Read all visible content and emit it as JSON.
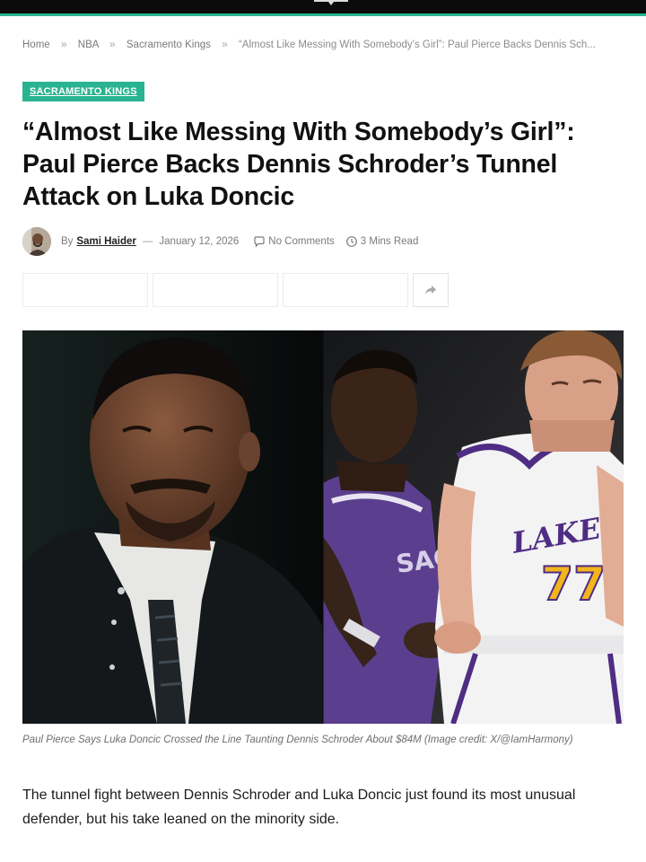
{
  "breadcrumb": {
    "items": [
      "Home",
      "NBA",
      "Sacramento Kings"
    ],
    "separator": "»",
    "current": "“Almost Like Messing With Somebody’s Girl”: Paul Pierce Backs Dennis Sch..."
  },
  "article": {
    "category": "SACRAMENTO KINGS",
    "title": "“Almost Like Messing With Somebody’s Girl”: Paul Pierce Backs Dennis Schroder’s Tunnel Attack on Luka Doncic",
    "by_label": "By",
    "author": "Sami Haider",
    "date": "January 12, 2026",
    "comments": "No Comments",
    "read_time": "3 Mins Read",
    "image_caption": "Paul Pierce Says Luka Doncic Crossed the Line Taunting Dennis Schroder About $84M (Image credit: X/@IamHarmony)",
    "lead_paragraph": "The tunnel fight between Dennis Schroder and Luka Doncic just found its most unusual defender, but his take leaned on the minority side."
  },
  "hero_image": {
    "jersey_text_left": "SAC",
    "jersey_team_right": "LAKERS",
    "jersey_number_right": "77"
  },
  "icons": {
    "comments": "comment-icon",
    "read_time": "clock-icon",
    "share_more": "share-icon"
  },
  "colors": {
    "accent": "#2ab391",
    "topbar": "#0b0b0b",
    "meta_text": "#7b7b7b"
  }
}
